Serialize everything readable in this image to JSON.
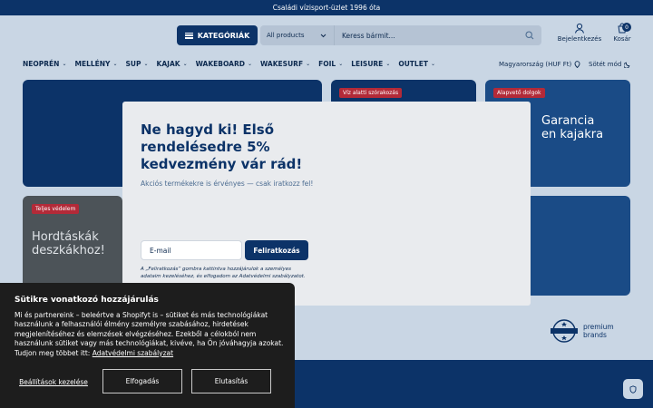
{
  "announcement": "Családi vízisport-üzlet 1996 óta",
  "header": {
    "categories_label": "KATEGÓRIÁK",
    "search_select": "All products",
    "search_placeholder": "Keress bármit...",
    "account_label": "Bejelentkezés",
    "cart_label": "Kosár",
    "cart_count": "0"
  },
  "nav": {
    "items": [
      "NEOPRÉN",
      "MELLÉNY",
      "SUP",
      "KAJAK",
      "WAKEBOARD",
      "WAKESURF",
      "FOIL",
      "LEISURE",
      "OUTLET"
    ],
    "region": "Magyarország (HUF Ft)",
    "dark_mode": "Sötét mód"
  },
  "cards": {
    "tag_underwater": "Víz alatti szórakozás",
    "tag_basics": "Alapvető dolgok",
    "basics_text": "Garancia\nen kajakra",
    "tag_protection": "Teljes védelem",
    "bags_text": "Hordtáskák\ndeszkákhoz!"
  },
  "modal": {
    "title": "Ne hagyd ki! Első rendelésedre 5% kedvezmény vár rád!",
    "subtitle": "Akciós termékekre is érvényes — csak iratkozz fel!",
    "email_placeholder": "E-mail",
    "subscribe_label": "Feliratkozás",
    "legal": "A „Feliratkozás” gombra kattintva hozzájárulok a személyes adataim kezeléséhez, és elfogadom az Adatvédelmi szabályzatot."
  },
  "premium_brands": "premium brands",
  "cookie": {
    "title": "Sütikre vonatkozó hozzájárulás",
    "body": "Mi és partnereink – beleértve a Shopifyt is – sütiket és más technológiákat használunk a felhasználói élmény személyre szabásához, hirdetések megjelenítéséhez és elemzések elvégzéséhez. Ezekből a célokból nem használunk sütiket vagy más technológiákat, kivéve, ha Ön jóváhagyja azokat. Tudjon meg többet itt:",
    "policy_link": "Adatvédelmi szabályzat",
    "settings_label": "Beállítások kezelése",
    "accept_label": "Elfogadás",
    "reject_label": "Elutasítás"
  },
  "colors": {
    "brand_navy": "#0c3368",
    "background": "#c9d6e4",
    "tag_red": "#b32a38",
    "cookie_bg": "#1d1d1d"
  }
}
